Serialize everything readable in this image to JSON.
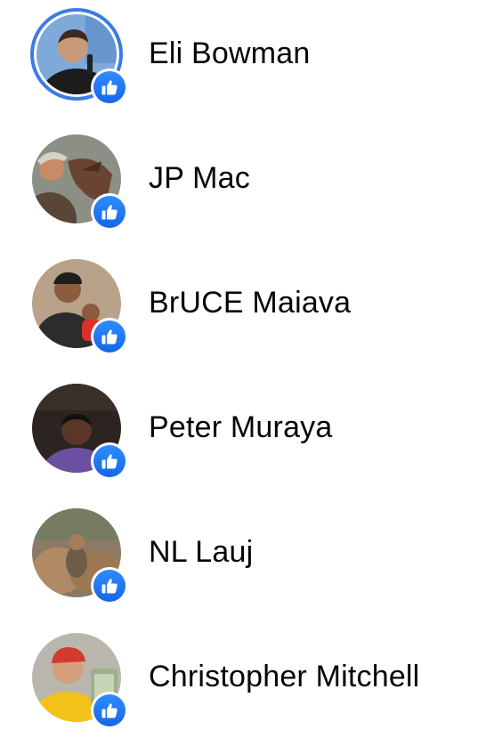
{
  "reactions": [
    {
      "name": "Eli Bowman",
      "reaction": "like",
      "has_story": true,
      "avatar": {
        "bg": "#7fa9d8",
        "skin": "#c89a7a",
        "shirt": "#1c1c1e",
        "hair": "#3a2a20"
      }
    },
    {
      "name": "JP Mac",
      "reaction": "like",
      "has_story": false,
      "avatar": {
        "bg": "#8c8f86",
        "skin": "#c98b66",
        "shirt": "#5a4636",
        "hair": "#7a4a32"
      }
    },
    {
      "name": "BrUCE Maiava",
      "reaction": "like",
      "has_story": false,
      "avatar": {
        "bg": "#b8a38a",
        "skin": "#8d5b3e",
        "shirt": "#2c2c2c",
        "hair": "#1e1e1e"
      }
    },
    {
      "name": "Peter Muraya",
      "reaction": "like",
      "has_story": false,
      "avatar": {
        "bg": "#2b2421",
        "skin": "#5a3626",
        "shirt": "#6b4fa0",
        "hair": "#151010"
      }
    },
    {
      "name": "NL Lauj",
      "reaction": "like",
      "has_story": false,
      "avatar": {
        "bg": "#8a7a66",
        "skin": "#a47e5c",
        "shirt": "#6d5c48",
        "hair": "#4a3b2d"
      }
    },
    {
      "name": "Christopher Mitchell",
      "reaction": "like",
      "has_story": false,
      "avatar": {
        "bg": "#b9b6ad",
        "skin": "#d4a07c",
        "shirt": "#f2c21a",
        "hair": "#d23a2f"
      }
    }
  ],
  "colors": {
    "like_badge": "#1877f2",
    "story_ring": "#3b7be6",
    "name_text": "#050505",
    "background": "#ffffff"
  },
  "icons": {
    "reaction_badge": "thumbs-up-icon"
  }
}
